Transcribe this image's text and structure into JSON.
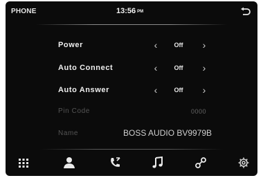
{
  "header": {
    "title": "PHONE",
    "time": "13:56",
    "ampm": "PM"
  },
  "settings": [
    {
      "label": "Power",
      "value": "Off"
    },
    {
      "label": "Auto Connect",
      "value": "Off"
    },
    {
      "label": "Auto Answer",
      "value": "Off"
    }
  ],
  "pin": {
    "label": "Pin Code",
    "value": "0000"
  },
  "name": {
    "label": "Name",
    "value": "BOSS AUDIO BV9979B"
  },
  "nav": [
    "keypad-icon",
    "contacts-icon",
    "call-log-icon",
    "music-icon",
    "bluetooth-link-icon",
    "settings-icon"
  ],
  "colors": {
    "background": "#0b0b0b",
    "text": "#efefef",
    "dim_text": "#555555"
  }
}
